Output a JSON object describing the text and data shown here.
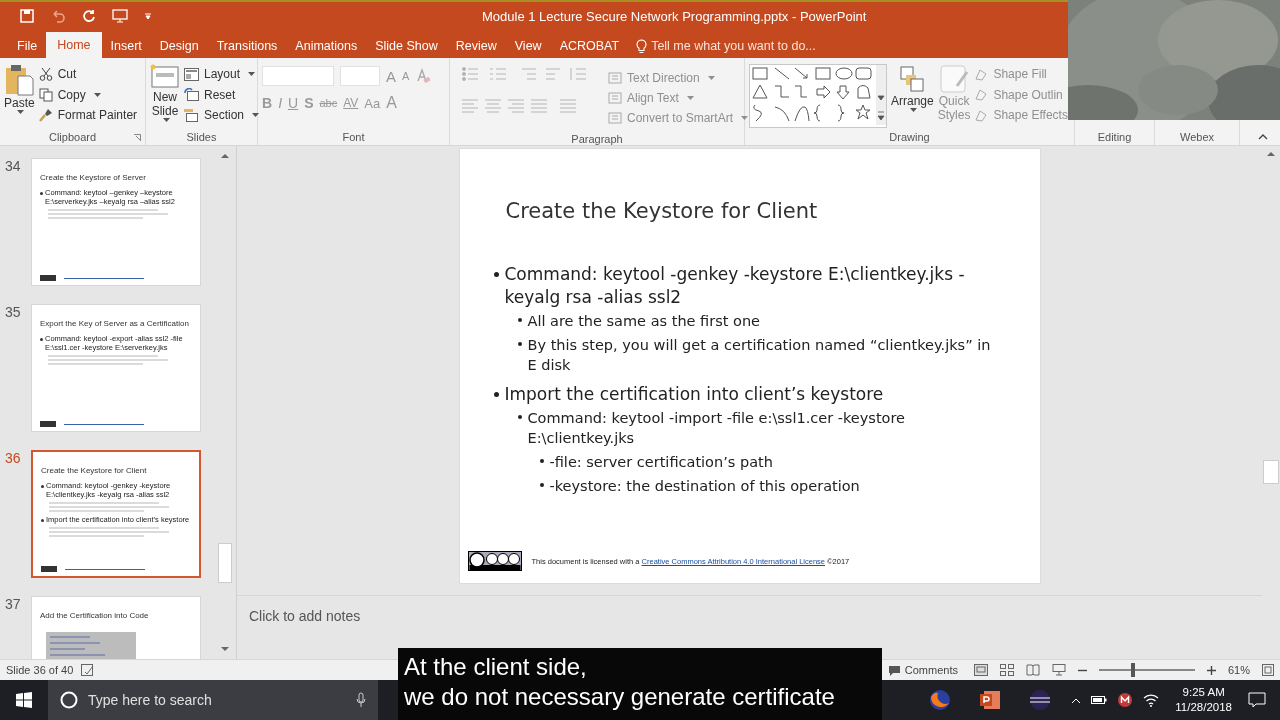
{
  "window": {
    "title": "Module 1 Lecture Secure Network Programming.pptx - PowerPoint"
  },
  "tabs": [
    {
      "label": "File",
      "selected": false
    },
    {
      "label": "Home",
      "selected": true
    },
    {
      "label": "Insert",
      "selected": false
    },
    {
      "label": "Design",
      "selected": false
    },
    {
      "label": "Transitions",
      "selected": false
    },
    {
      "label": "Animations",
      "selected": false
    },
    {
      "label": "Slide Show",
      "selected": false
    },
    {
      "label": "Review",
      "selected": false
    },
    {
      "label": "View",
      "selected": false
    },
    {
      "label": "ACROBAT",
      "selected": false
    }
  ],
  "tell_me": {
    "placeholder": "Tell me what you want to do..."
  },
  "ribbon": {
    "clipboard": {
      "label": "Clipboard",
      "paste": "Paste",
      "cut": "Cut",
      "copy": "Copy",
      "format_painter": "Format Painter"
    },
    "slides": {
      "label": "Slides",
      "new_slide": [
        "New",
        "Slide"
      ],
      "layout": "Layout",
      "reset": "Reset",
      "section": "Section"
    },
    "font": {
      "label": "Font",
      "size_buttons": [
        "A",
        "A"
      ],
      "format_buttons": [
        "B",
        "I",
        "U",
        "S",
        "abc",
        "AV",
        "Aa",
        "A"
      ]
    },
    "paragraph": {
      "label": "Paragraph",
      "commands": [
        "Text Direction",
        "Align Text",
        "Convert to SmartArt"
      ]
    },
    "drawing": {
      "label": "Drawing",
      "arrange": "Arrange",
      "quick_styles": [
        "Quick",
        "Styles"
      ],
      "shape_commands": [
        "Shape Fill",
        "Shape Outlin",
        "Shape Effects"
      ]
    },
    "editing": {
      "label": "Editing"
    },
    "webex": {
      "label": "Webex"
    }
  },
  "thumbnails": [
    {
      "number": "34",
      "selected": false,
      "title": "Create the Keystore of Server",
      "bullets": [
        "Command: keytool –genkey –keystore E:\\serverkey.jks –keyalg rsa –alias ssl2"
      ]
    },
    {
      "number": "35",
      "selected": false,
      "title": "Export the Key of Server as a Certification",
      "bullets": [
        "Command: keytool -export -alias ssl2 -file E:\\ssl1.cer -keystore E:\\serverkey.jks"
      ]
    },
    {
      "number": "36",
      "selected": true,
      "title": "Create the Keystore for Client",
      "bullets": [
        "Command: keytool -genkey -keystore E:\\clientkey.jks -keyalg rsa -alias ssl2",
        "Import the certification into client’s keystore"
      ]
    },
    {
      "number": "37",
      "selected": false,
      "title": "Add the Certification into Code"
    }
  ],
  "slide": {
    "title": "Create the Keystore for Client",
    "bullets": [
      {
        "text": "Command: keytool -genkey -keystore E:\\clientkey.jks -keyalg rsa -alias ssl2",
        "children": [
          {
            "text": "All are the same as the first one"
          },
          {
            "text": "By this step, you will get a certification named “clientkey.jks” in E disk"
          }
        ]
      },
      {
        "text": "Import the certification into client’s keystore",
        "children": [
          {
            "text": "Command: keytool -import -file e:\\ssl1.cer -keystore E:\\clientkey.jks",
            "children": [
              {
                "text": "-file: server certification’s path"
              },
              {
                "text": "-keystore: the destination of this operation"
              }
            ]
          }
        ]
      }
    ],
    "footer": {
      "text": "This document is licensed with a",
      "link": "Creative Commons Attribution 4.0 International License",
      "year": "©2017"
    }
  },
  "notes": {
    "placeholder": "Click to add notes"
  },
  "status_bar": {
    "slide_count": "Slide 36 of 40",
    "comments": "Comments",
    "zoom": {
      "level": 0.35,
      "reading": "61%"
    }
  },
  "taskbar": {
    "search": {
      "placeholder": "Type here to search"
    },
    "time": "9:25 AM",
    "date": "11/28/2018"
  },
  "subtitle": {
    "lines": [
      "At the client side,",
      "we do not necessary generate certificate"
    ]
  }
}
